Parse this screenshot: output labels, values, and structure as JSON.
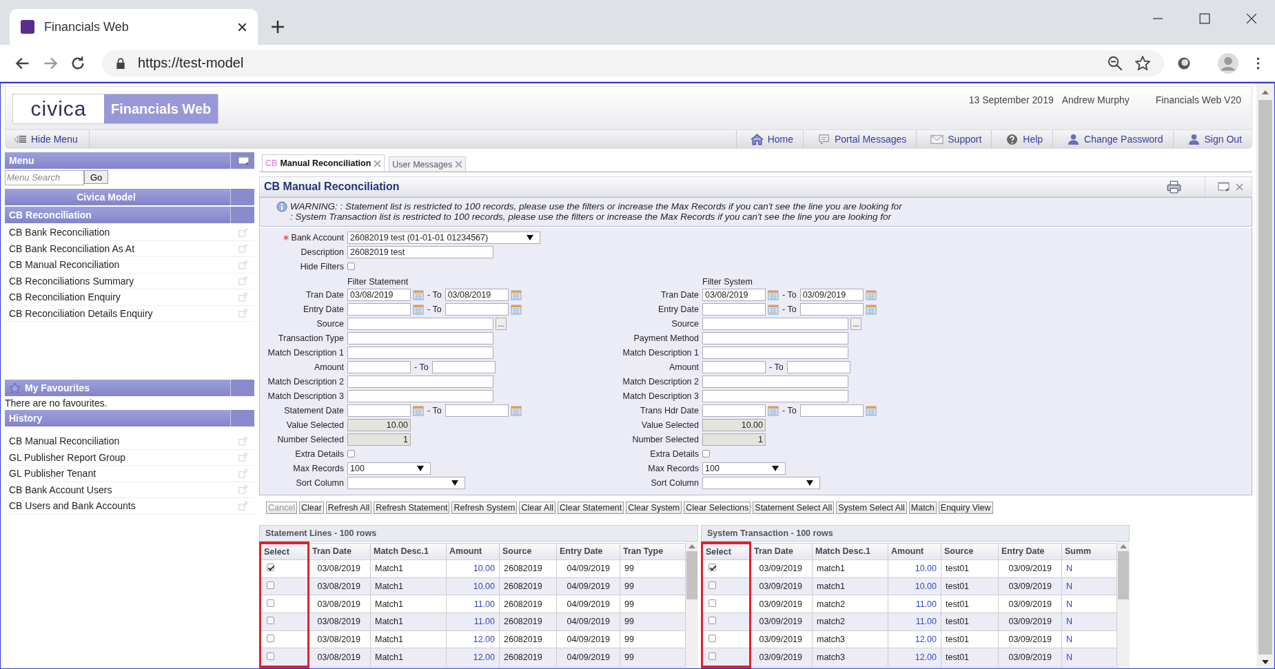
{
  "browser": {
    "tab_title": "Financials Web",
    "url": "https://test-model"
  },
  "header": {
    "logo": "civica",
    "app_name": "Financials Web",
    "date": "13 September 2019",
    "user": "Andrew Murphy",
    "version": "Financials Web V20"
  },
  "toolbar": {
    "hide_menu": "Hide Menu",
    "links": [
      {
        "label": "Home",
        "kind": "home"
      },
      {
        "label": "Portal Messages",
        "kind": "bubble"
      },
      {
        "label": "Support",
        "kind": "envelope"
      },
      {
        "label": "Help",
        "kind": "help"
      },
      {
        "label": "Change Password",
        "kind": "person"
      },
      {
        "label": "Sign Out",
        "kind": "person"
      }
    ]
  },
  "sidebar": {
    "menu_title": "Menu",
    "search_placeholder": "Menu Search",
    "go": "Go",
    "model": "Civica Model",
    "section": "CB Reconciliation",
    "items": [
      "CB Bank Reconciliation",
      "CB Bank Reconciliation As At",
      "CB Manual Reconciliation",
      "CB Reconciliations Summary",
      "CB Reconciliation Enquiry",
      "CB Reconciliation Details Enquiry"
    ],
    "favourites_title": "My Favourites",
    "favourites_empty": "There are no favourites.",
    "history_title": "History",
    "history": [
      "CB Manual Reconciliation",
      "GL Publisher Report Group",
      "GL Publisher Tenant",
      "CB Bank Account Users",
      "CB Users and Bank Accounts"
    ]
  },
  "tabs": [
    {
      "prefix": "CB",
      "label": "Manual Reconciliation",
      "selected": true
    },
    {
      "label": "User Messages",
      "selected": false
    }
  ],
  "panel": {
    "title": "CB Manual Reconciliation",
    "warnings": [
      "WARNING: : Statement list is restricted to 100 records, please use the filters or increase the Max Records if you can't see the line you are looking for",
      ": System Transaction list is restricted to 100 records, please use the filters or increase the Max Records if you can't see the line you are looking for"
    ]
  },
  "form": {
    "top": [
      {
        "kind": "select",
        "label": "Bank Account",
        "required": true,
        "value": "26082019 test (01-01-01 01234567)"
      },
      {
        "kind": "text",
        "label": "Description",
        "value": "26082019 test"
      },
      {
        "kind": "checkbox",
        "label": "Hide Filters",
        "checked": false
      }
    ],
    "filters": [
      {
        "heading": "Filter Statement",
        "fields": [
          {
            "kind": "date_range",
            "label": "Tran Date",
            "from": "03/08/2019",
            "to_label": "- To",
            "to": "03/08/2019"
          },
          {
            "kind": "date_range",
            "label": "Entry Date",
            "to_label": "- To"
          },
          {
            "kind": "lookup",
            "label": "Source",
            "button": "..."
          },
          {
            "kind": "text",
            "label": "Transaction Type"
          },
          {
            "kind": "text",
            "label": "Match Description 1"
          },
          {
            "kind": "amount_range",
            "label": "Amount",
            "to_label": "- To"
          },
          {
            "kind": "text",
            "label": "Match Description 2"
          },
          {
            "kind": "text",
            "label": "Match Description 3"
          },
          {
            "kind": "date_range",
            "label": "Statement Date",
            "to_label": "- To"
          },
          {
            "kind": "readonly",
            "label": "Value Selected",
            "value": "10.00"
          },
          {
            "kind": "readonly",
            "label": "Number Selected",
            "value": "1"
          },
          {
            "kind": "checkbox",
            "label": "Extra Details",
            "checked": false
          },
          {
            "kind": "small_select",
            "label": "Max Records",
            "value": "100"
          },
          {
            "kind": "select",
            "label": "Sort Column"
          }
        ]
      },
      {
        "heading": "Filter System",
        "fields": [
          {
            "kind": "date_range",
            "label": "Tran Date",
            "from": "03/08/2019",
            "to_label": "- To",
            "to": "03/09/2019"
          },
          {
            "kind": "date_range",
            "label": "Entry Date",
            "to_label": "- To"
          },
          {
            "kind": "lookup",
            "label": "Source",
            "button": "..."
          },
          {
            "kind": "text",
            "label": "Payment Method"
          },
          {
            "kind": "text",
            "label": "Match Description 1"
          },
          {
            "kind": "amount_range",
            "label": "Amount",
            "to_label": "- To"
          },
          {
            "kind": "text",
            "label": "Match Description 2"
          },
          {
            "kind": "text",
            "label": "Match Description 3"
          },
          {
            "kind": "date_range",
            "label": "Trans Hdr Date",
            "to_label": "- To"
          },
          {
            "kind": "readonly",
            "label": "Value Selected",
            "value": "10.00"
          },
          {
            "kind": "readonly",
            "label": "Number Selected",
            "value": "1"
          },
          {
            "kind": "checkbox",
            "label": "Extra Details",
            "checked": false
          },
          {
            "kind": "small_select",
            "label": "Max Records",
            "value": "100"
          },
          {
            "kind": "select",
            "label": "Sort Column"
          }
        ]
      }
    ]
  },
  "buttons": [
    {
      "label": "Cancel",
      "disabled": true
    },
    {
      "label": "Clear",
      "disabled": false
    },
    {
      "label": "Refresh All",
      "disabled": false
    },
    {
      "label": "Refresh Statement",
      "disabled": false
    },
    {
      "label": "Refresh System",
      "disabled": false
    },
    {
      "label": "Clear All",
      "disabled": false
    },
    {
      "label": "Clear Statement",
      "disabled": false
    },
    {
      "label": "Clear System",
      "disabled": false
    },
    {
      "label": "Clear Selections",
      "disabled": false
    },
    {
      "label": "Statement Select All",
      "disabled": false
    },
    {
      "label": "System Select All",
      "disabled": false
    },
    {
      "label": "Match",
      "disabled": false
    },
    {
      "label": "Enquiry View",
      "disabled": false
    }
  ],
  "tables": [
    {
      "title": "Statement Lines - 100 rows",
      "select_header": "Select",
      "select_highlighted": true,
      "columns": [
        {
          "label": "Tran Date",
          "kind": "date"
        },
        {
          "label": "Match Desc.1",
          "kind": "text"
        },
        {
          "label": "Amount",
          "kind": "amount"
        },
        {
          "label": "Source",
          "kind": "text"
        },
        {
          "label": "Entry Date",
          "kind": "date"
        },
        {
          "label": "Tran Type",
          "kind": "text"
        }
      ],
      "rows": [
        {
          "selected": true,
          "cells": [
            "03/08/2019",
            "Match1",
            "10.00",
            "26082019",
            "04/09/2019",
            "99"
          ]
        },
        {
          "selected": false,
          "cells": [
            "03/08/2019",
            "Match1",
            "10.00",
            "26082019",
            "04/09/2019",
            "99"
          ]
        },
        {
          "selected": false,
          "cells": [
            "03/08/2019",
            "Match1",
            "11.00",
            "26082019",
            "04/09/2019",
            "99"
          ]
        },
        {
          "selected": false,
          "cells": [
            "03/08/2019",
            "Match1",
            "11.00",
            "26082019",
            "04/09/2019",
            "99"
          ]
        },
        {
          "selected": false,
          "cells": [
            "03/08/2019",
            "Match1",
            "12.00",
            "26082019",
            "04/09/2019",
            "99"
          ]
        },
        {
          "selected": false,
          "cells": [
            "03/08/2019",
            "Match1",
            "12.00",
            "26082019",
            "04/09/2019",
            "99"
          ]
        }
      ]
    },
    {
      "title": "System Transaction - 100 rows",
      "select_header": "Select",
      "select_highlighted": true,
      "columns": [
        {
          "label": "Tran Date",
          "kind": "date"
        },
        {
          "label": "Match Desc.1",
          "kind": "text"
        },
        {
          "label": "Amount",
          "kind": "amount"
        },
        {
          "label": "Source",
          "kind": "text"
        },
        {
          "label": "Entry Date",
          "kind": "date"
        },
        {
          "label": "Summ",
          "kind": "flag"
        }
      ],
      "rows": [
        {
          "selected": true,
          "cells": [
            "03/09/2019",
            "match1",
            "10.00",
            "test01",
            "03/09/2019",
            "N"
          ]
        },
        {
          "selected": false,
          "cells": [
            "03/09/2019",
            "match1",
            "10.00",
            "test01",
            "03/09/2019",
            "N"
          ]
        },
        {
          "selected": false,
          "cells": [
            "03/09/2019",
            "match2",
            "11.00",
            "test01",
            "03/09/2019",
            "N"
          ]
        },
        {
          "selected": false,
          "cells": [
            "03/09/2019",
            "match2",
            "11.00",
            "test01",
            "03/09/2019",
            "N"
          ]
        },
        {
          "selected": false,
          "cells": [
            "03/09/2019",
            "match3",
            "12.00",
            "test01",
            "03/09/2019",
            "N"
          ]
        },
        {
          "selected": false,
          "cells": [
            "03/09/2019",
            "match3",
            "12.00",
            "test01",
            "03/09/2019",
            "N"
          ]
        }
      ]
    }
  ]
}
